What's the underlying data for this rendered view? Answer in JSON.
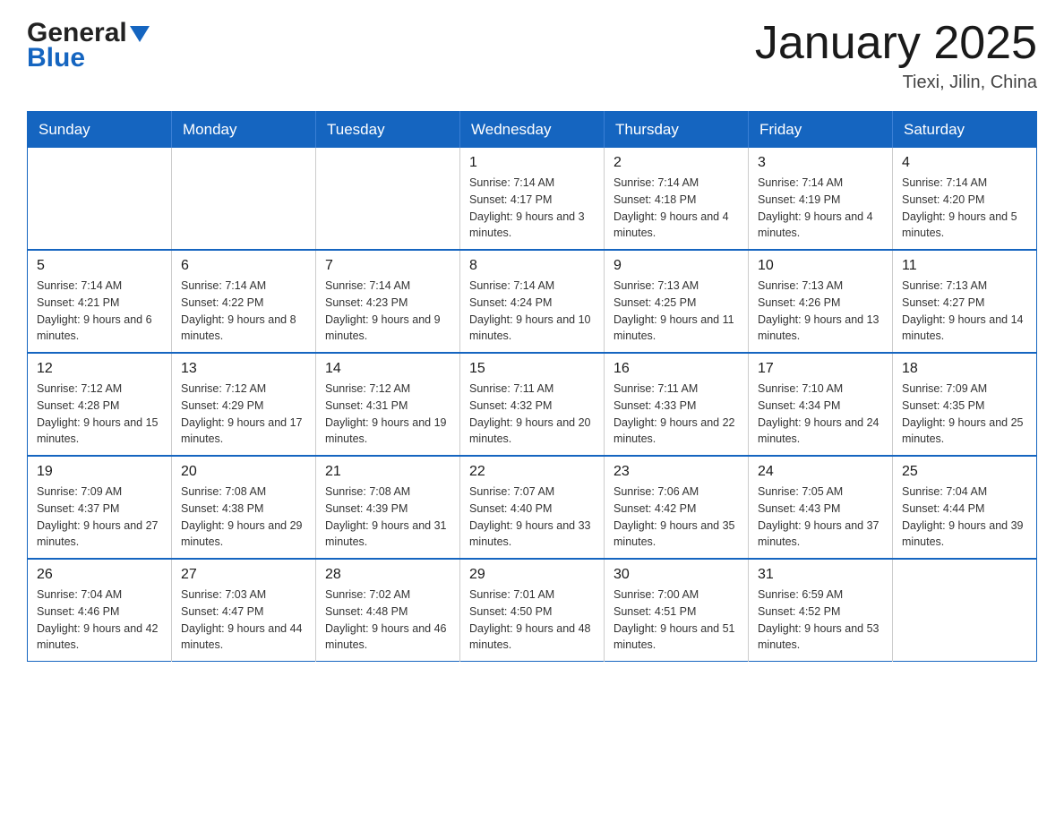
{
  "logo": {
    "line1": "General",
    "line2": "Blue",
    "arrow_color": "#1565C0"
  },
  "header": {
    "title": "January 2025",
    "subtitle": "Tiexi, Jilin, China"
  },
  "weekdays": [
    "Sunday",
    "Monday",
    "Tuesday",
    "Wednesday",
    "Thursday",
    "Friday",
    "Saturday"
  ],
  "weeks": [
    [
      {
        "day": "",
        "info": ""
      },
      {
        "day": "",
        "info": ""
      },
      {
        "day": "",
        "info": ""
      },
      {
        "day": "1",
        "info": "Sunrise: 7:14 AM\nSunset: 4:17 PM\nDaylight: 9 hours\nand 3 minutes."
      },
      {
        "day": "2",
        "info": "Sunrise: 7:14 AM\nSunset: 4:18 PM\nDaylight: 9 hours\nand 4 minutes."
      },
      {
        "day": "3",
        "info": "Sunrise: 7:14 AM\nSunset: 4:19 PM\nDaylight: 9 hours\nand 4 minutes."
      },
      {
        "day": "4",
        "info": "Sunrise: 7:14 AM\nSunset: 4:20 PM\nDaylight: 9 hours\nand 5 minutes."
      }
    ],
    [
      {
        "day": "5",
        "info": "Sunrise: 7:14 AM\nSunset: 4:21 PM\nDaylight: 9 hours\nand 6 minutes."
      },
      {
        "day": "6",
        "info": "Sunrise: 7:14 AM\nSunset: 4:22 PM\nDaylight: 9 hours\nand 8 minutes."
      },
      {
        "day": "7",
        "info": "Sunrise: 7:14 AM\nSunset: 4:23 PM\nDaylight: 9 hours\nand 9 minutes."
      },
      {
        "day": "8",
        "info": "Sunrise: 7:14 AM\nSunset: 4:24 PM\nDaylight: 9 hours\nand 10 minutes."
      },
      {
        "day": "9",
        "info": "Sunrise: 7:13 AM\nSunset: 4:25 PM\nDaylight: 9 hours\nand 11 minutes."
      },
      {
        "day": "10",
        "info": "Sunrise: 7:13 AM\nSunset: 4:26 PM\nDaylight: 9 hours\nand 13 minutes."
      },
      {
        "day": "11",
        "info": "Sunrise: 7:13 AM\nSunset: 4:27 PM\nDaylight: 9 hours\nand 14 minutes."
      }
    ],
    [
      {
        "day": "12",
        "info": "Sunrise: 7:12 AM\nSunset: 4:28 PM\nDaylight: 9 hours\nand 15 minutes."
      },
      {
        "day": "13",
        "info": "Sunrise: 7:12 AM\nSunset: 4:29 PM\nDaylight: 9 hours\nand 17 minutes."
      },
      {
        "day": "14",
        "info": "Sunrise: 7:12 AM\nSunset: 4:31 PM\nDaylight: 9 hours\nand 19 minutes."
      },
      {
        "day": "15",
        "info": "Sunrise: 7:11 AM\nSunset: 4:32 PM\nDaylight: 9 hours\nand 20 minutes."
      },
      {
        "day": "16",
        "info": "Sunrise: 7:11 AM\nSunset: 4:33 PM\nDaylight: 9 hours\nand 22 minutes."
      },
      {
        "day": "17",
        "info": "Sunrise: 7:10 AM\nSunset: 4:34 PM\nDaylight: 9 hours\nand 24 minutes."
      },
      {
        "day": "18",
        "info": "Sunrise: 7:09 AM\nSunset: 4:35 PM\nDaylight: 9 hours\nand 25 minutes."
      }
    ],
    [
      {
        "day": "19",
        "info": "Sunrise: 7:09 AM\nSunset: 4:37 PM\nDaylight: 9 hours\nand 27 minutes."
      },
      {
        "day": "20",
        "info": "Sunrise: 7:08 AM\nSunset: 4:38 PM\nDaylight: 9 hours\nand 29 minutes."
      },
      {
        "day": "21",
        "info": "Sunrise: 7:08 AM\nSunset: 4:39 PM\nDaylight: 9 hours\nand 31 minutes."
      },
      {
        "day": "22",
        "info": "Sunrise: 7:07 AM\nSunset: 4:40 PM\nDaylight: 9 hours\nand 33 minutes."
      },
      {
        "day": "23",
        "info": "Sunrise: 7:06 AM\nSunset: 4:42 PM\nDaylight: 9 hours\nand 35 minutes."
      },
      {
        "day": "24",
        "info": "Sunrise: 7:05 AM\nSunset: 4:43 PM\nDaylight: 9 hours\nand 37 minutes."
      },
      {
        "day": "25",
        "info": "Sunrise: 7:04 AM\nSunset: 4:44 PM\nDaylight: 9 hours\nand 39 minutes."
      }
    ],
    [
      {
        "day": "26",
        "info": "Sunrise: 7:04 AM\nSunset: 4:46 PM\nDaylight: 9 hours\nand 42 minutes."
      },
      {
        "day": "27",
        "info": "Sunrise: 7:03 AM\nSunset: 4:47 PM\nDaylight: 9 hours\nand 44 minutes."
      },
      {
        "day": "28",
        "info": "Sunrise: 7:02 AM\nSunset: 4:48 PM\nDaylight: 9 hours\nand 46 minutes."
      },
      {
        "day": "29",
        "info": "Sunrise: 7:01 AM\nSunset: 4:50 PM\nDaylight: 9 hours\nand 48 minutes."
      },
      {
        "day": "30",
        "info": "Sunrise: 7:00 AM\nSunset: 4:51 PM\nDaylight: 9 hours\nand 51 minutes."
      },
      {
        "day": "31",
        "info": "Sunrise: 6:59 AM\nSunset: 4:52 PM\nDaylight: 9 hours\nand 53 minutes."
      },
      {
        "day": "",
        "info": ""
      }
    ]
  ]
}
